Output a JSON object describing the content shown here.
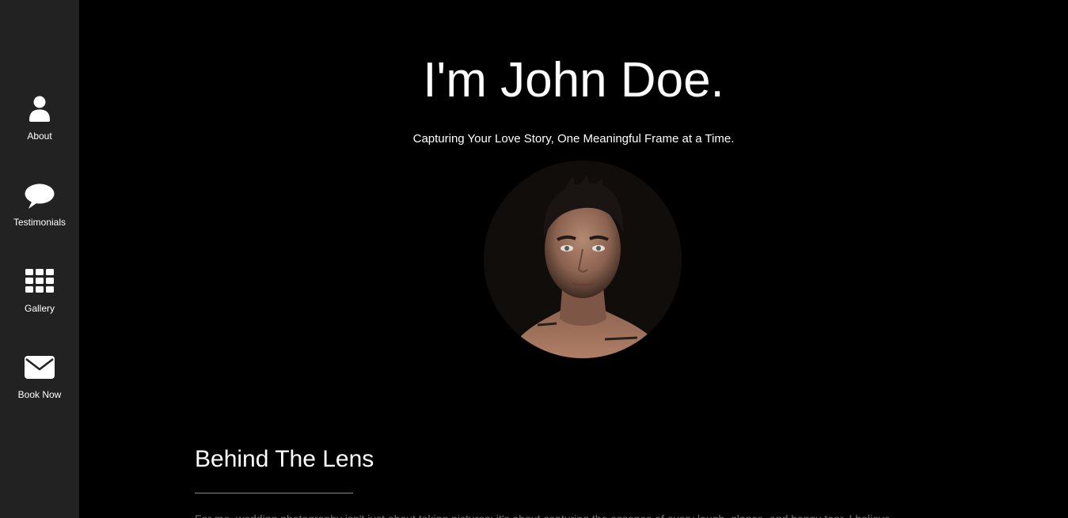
{
  "sidebar": {
    "items": [
      {
        "label": "About",
        "icon": "user-icon"
      },
      {
        "label": "Testimonials",
        "icon": "speech-bubble-icon"
      },
      {
        "label": "Gallery",
        "icon": "grid-icon"
      },
      {
        "label": "Book Now",
        "icon": "envelope-icon"
      }
    ]
  },
  "hero": {
    "title": "I'm John Doe.",
    "subtitle": "Capturing Your Love Story, One Meaningful Frame at a Time.",
    "avatar_alt": "portrait-photo"
  },
  "about": {
    "title": "Behind The Lens",
    "body": "For me, wedding photography isn't just about taking pictures; it's about capturing the essence of every laugh, glance, and happy tear. I believe"
  },
  "colors": {
    "page_background": "#000000",
    "sidebar_background": "#222222",
    "text_primary": "#ffffff",
    "text_muted": "#6f6f6f",
    "divider": "#8a8a8a"
  }
}
